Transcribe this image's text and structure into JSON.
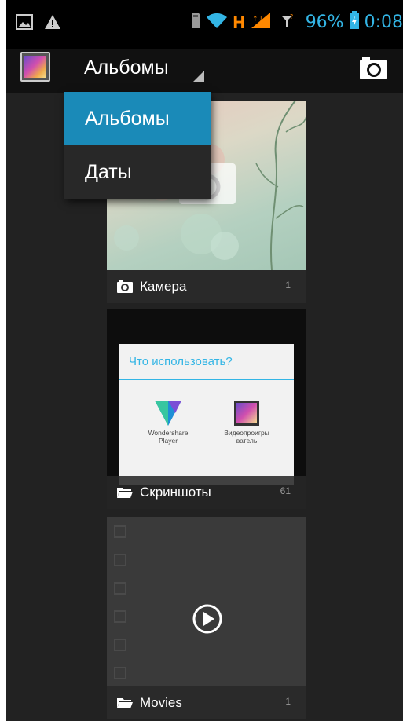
{
  "status_bar": {
    "battery_percent": "96%",
    "time": "0:08",
    "network_type": "H",
    "icons": [
      "gallery-notification-icon",
      "warning-icon",
      "sd-card-icon",
      "wifi-icon",
      "signal-icon",
      "no-sim-icon",
      "battery-charging-icon"
    ]
  },
  "action_bar": {
    "spinner_label": "Альбомы",
    "camera_button_icon": "camera-icon"
  },
  "dropdown": {
    "items": [
      {
        "label": "Альбомы",
        "selected": true
      },
      {
        "label": "Даты",
        "selected": false
      }
    ]
  },
  "albums": [
    {
      "name": "Камера",
      "count": "1",
      "icon": "camera-icon"
    },
    {
      "name": "Скриншоты",
      "count": "61",
      "icon": "folder-icon"
    },
    {
      "name": "Movies",
      "count": "1",
      "icon": "folder-icon"
    }
  ],
  "screenshot_thumb": {
    "dialog_title": "Что использовать?",
    "apps": [
      {
        "label_line1": "Wondershare",
        "label_line2": "Player"
      },
      {
        "label_line1": "Видеопроигры",
        "label_line2": "ватель"
      }
    ]
  },
  "colors": {
    "accent": "#33b5e5",
    "selected_item": "#1a8ab8",
    "background": "#222222"
  }
}
